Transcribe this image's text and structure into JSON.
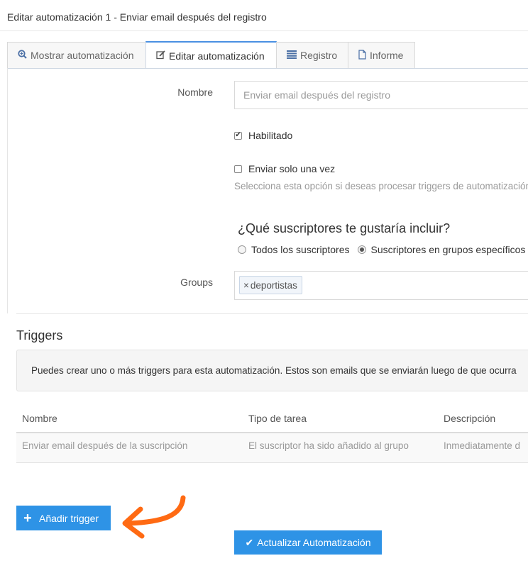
{
  "page": {
    "title": "Editar automatización 1 - Enviar email después del registro"
  },
  "tabs": [
    {
      "label": "Mostrar automatización",
      "icon": "zoom-in-icon",
      "active": false
    },
    {
      "label": "Editar automatización",
      "icon": "edit-icon",
      "active": true
    },
    {
      "label": "Registro",
      "icon": "list-icon",
      "active": false
    },
    {
      "label": "Informe",
      "icon": "file-icon",
      "active": false
    }
  ],
  "form": {
    "name_label": "Nombre",
    "name_placeholder": "Enviar email después del registro",
    "enabled_label": "Habilitado",
    "enabled_checked": true,
    "once_label": "Enviar solo una vez",
    "once_checked": false,
    "once_hint": "Selecciona esta opción si deseas procesar triggers de automatización",
    "subscribers_question": "¿Qué suscriptores te gustaría incluir?",
    "radio_all": "Todos los suscriptores",
    "radio_groups": "Suscriptores en grupos específicos",
    "radio_selected": "groups",
    "groups_label": "Groups",
    "groups_tag": "deportistas",
    "tag_remove": "×"
  },
  "triggers": {
    "title": "Triggers",
    "info": "Puedes crear uno o más triggers para esta automatización. Estos son emails que se enviarán luego de que ocurra",
    "columns": [
      "Nombre",
      "Tipo de tarea",
      "Descripción"
    ],
    "rows": [
      [
        "Enviar email después de la suscripción",
        "El suscriptor ha sido añadido al grupo",
        "Inmediatamente d"
      ]
    ]
  },
  "buttons": {
    "add_trigger": "Añadir trigger",
    "add_trigger_icon": "+",
    "update": "Actualizar Automatización",
    "update_icon": "✔"
  },
  "colors": {
    "accent": "#2e93e6",
    "tab_active_border": "#4a90e2",
    "arrow": "#ff6a13"
  }
}
